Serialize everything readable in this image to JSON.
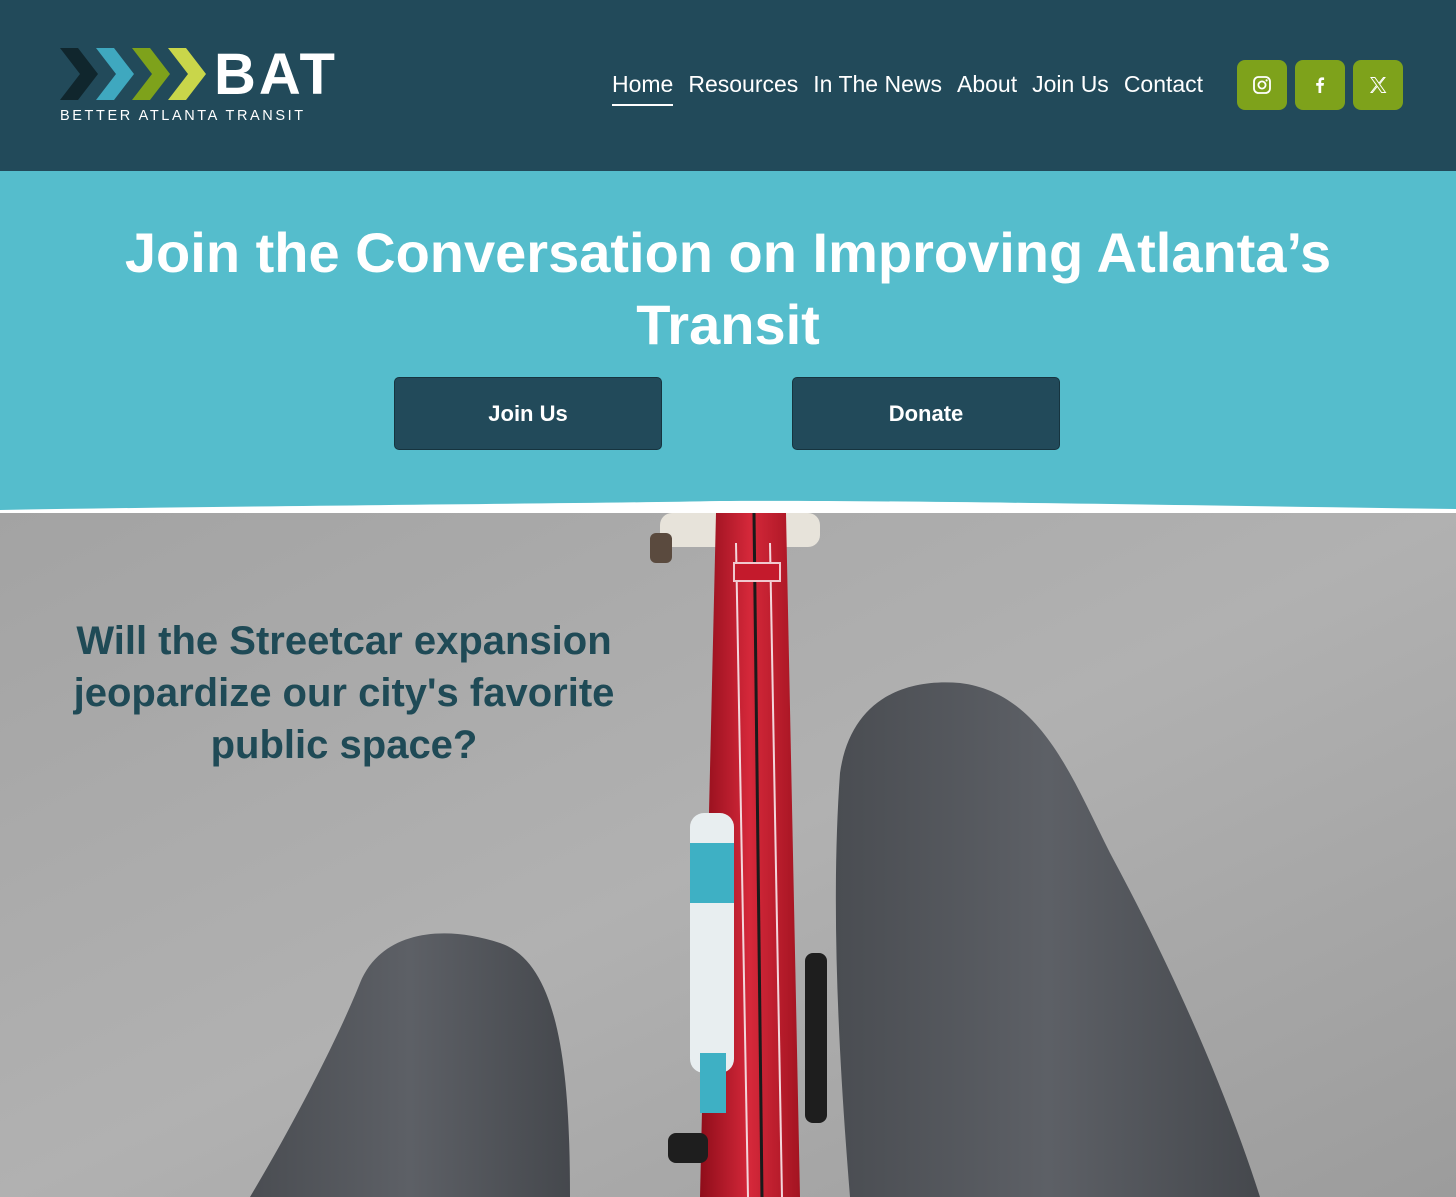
{
  "brand": {
    "name": "BAT",
    "tagline": "BETTER ATLANTA TRANSIT"
  },
  "nav": {
    "items": [
      {
        "label": "Home",
        "active": true
      },
      {
        "label": "Resources",
        "active": false
      },
      {
        "label": "In The News",
        "active": false
      },
      {
        "label": "About",
        "active": false
      },
      {
        "label": "Join Us",
        "active": false
      },
      {
        "label": "Contact",
        "active": false
      }
    ]
  },
  "social": {
    "icons": [
      "instagram-icon",
      "facebook-icon",
      "x-icon"
    ]
  },
  "hero": {
    "title": "Join the Conversation on Improving Atlanta’s Transit",
    "join_label": "Join Us",
    "donate_label": "Donate"
  },
  "feature": {
    "caption": "Will the Streetcar expansion jeopardize our city's favorite public space?"
  },
  "colors": {
    "header_bg": "#224a5a",
    "hero_bg": "#55bdcc",
    "social_bg": "#7ea21b",
    "button_bg": "#224a5a",
    "caption_text": "#1f4a56"
  }
}
